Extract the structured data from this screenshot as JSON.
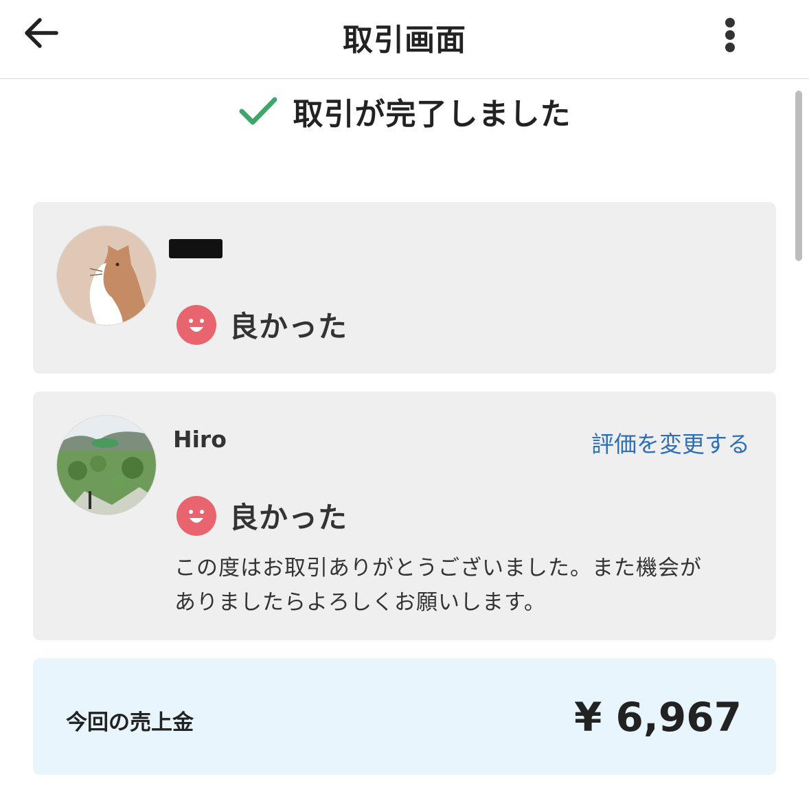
{
  "header": {
    "title": "取引画面",
    "back_icon": "arrow-left-icon",
    "menu_icon": "more-vertical-icon"
  },
  "status": {
    "text": "取引が完了しました",
    "icon": "check-icon",
    "color": "#3fa66b"
  },
  "reviews": [
    {
      "username": "",
      "rating": "良かった",
      "rating_icon": "smile-face-icon"
    },
    {
      "username": "Hiro",
      "change_link": "評価を変更する",
      "rating": "良かった",
      "rating_icon": "smile-face-icon",
      "comment_line1": "この度はお取引ありがとうございました。また機会が",
      "comment_line2": "ありましたらよろしくお願いします。"
    }
  ],
  "sales": {
    "label": "今回の売上金",
    "amount": "¥ 6,967"
  },
  "colors": {
    "accent_link": "#2f6fb5",
    "smile_red": "#e8646e",
    "sales_bg": "#e9f5fc",
    "card_bg": "#efefef"
  }
}
